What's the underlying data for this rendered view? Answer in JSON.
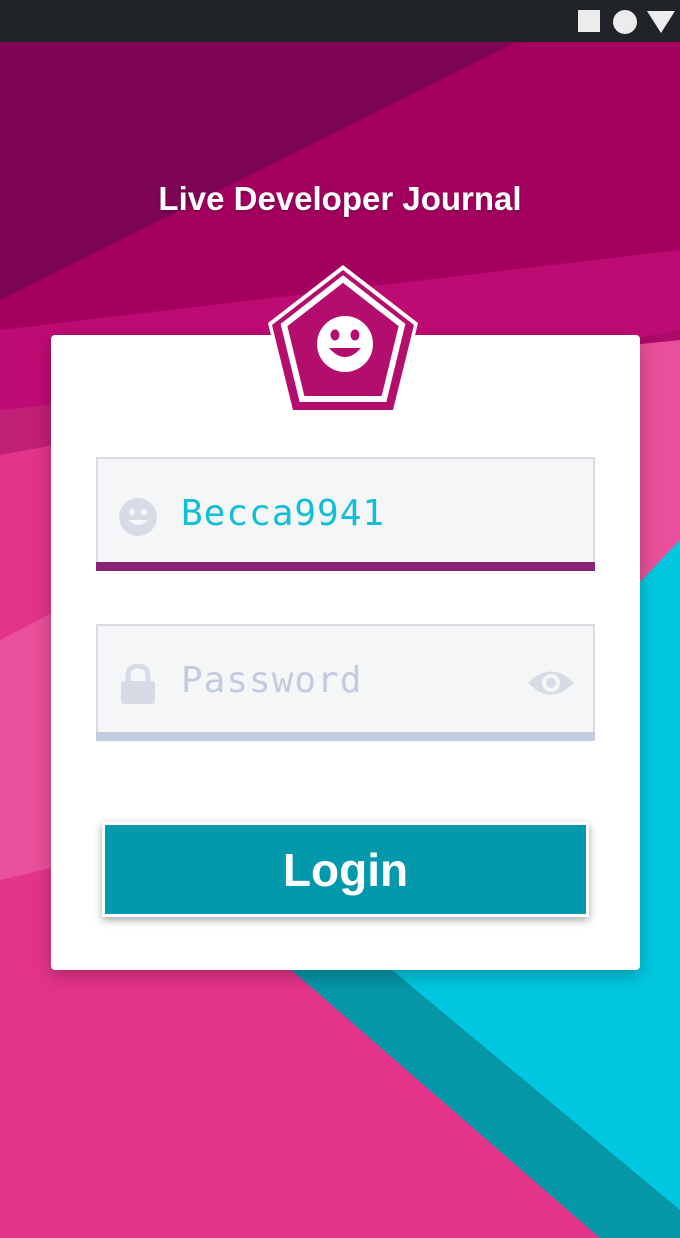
{
  "status_bar": {
    "icons": [
      "square-icon",
      "circle-icon",
      "triangle-icon"
    ]
  },
  "app": {
    "title": "Live Developer Journal"
  },
  "badge": {
    "icon": "smiley-face-icon"
  },
  "username": {
    "value": "Becca9941",
    "icon": "smiley-face-icon"
  },
  "password": {
    "placeholder": "Password",
    "icon": "lock-icon",
    "toggle_icon": "eye-icon"
  },
  "login": {
    "label": "Login"
  },
  "colors": {
    "primary": "#a0005e",
    "accent_pink": "#e4348a",
    "accent_cyan": "#00c8e0",
    "button": "#0399ad",
    "active_underline": "#8a2472",
    "input_text": "#12bdd6",
    "placeholder": "#c3cbe0"
  }
}
